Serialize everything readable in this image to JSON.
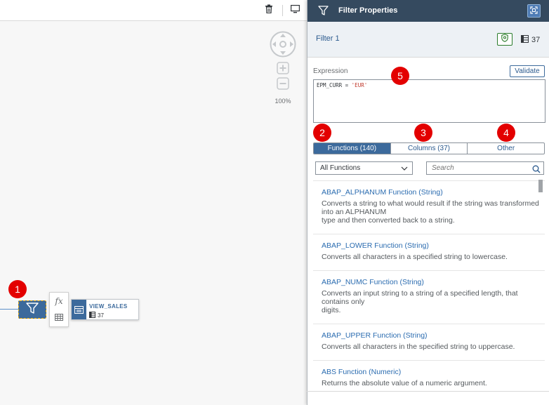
{
  "canvas": {
    "zoom_label": "100%",
    "node_menu": {
      "formula_label": "fx"
    },
    "view_node": {
      "name": "VIEW_SALES",
      "count": "37"
    }
  },
  "panel": {
    "title": "Filter Properties",
    "filter_name": "Filter 1",
    "column_count": "37",
    "expression_label": "Expression",
    "validate_label": "Validate",
    "expression": {
      "prefix": "EPM_CURR = ",
      "literal": "'EUR'"
    },
    "tabs": [
      {
        "label": "Functions (140)",
        "active": true
      },
      {
        "label": "Columns (37)",
        "active": false
      },
      {
        "label": "Other",
        "active": false
      }
    ],
    "function_filter": "All Functions",
    "search_placeholder": "Search",
    "functions": [
      {
        "name": "ABAP_ALPHANUM Function (String)",
        "desc": [
          "Converts a string to what would result if the string was transformed into an ALPHANUM",
          "type and then converted back to a string."
        ]
      },
      {
        "name": "ABAP_LOWER Function (String)",
        "desc": [
          "Converts all characters in a specified string to lowercase."
        ]
      },
      {
        "name": "ABAP_NUMC Function (String)",
        "desc": [
          "Converts an input string to a string of a specified length, that contains only",
          "digits."
        ]
      },
      {
        "name": "ABAP_UPPER Function (String)",
        "desc": [
          "Converts all characters in the specified string to uppercase."
        ]
      },
      {
        "name": "ABS Function (Numeric)",
        "desc": [
          "Returns the absolute value of a numeric argument."
        ]
      }
    ]
  },
  "callouts": [
    "1",
    "2",
    "3",
    "4",
    "5"
  ],
  "colors": {
    "header": "#354a5f",
    "accent": "#3c6a9c",
    "badge": "#e30000",
    "link": "#2b6cb0"
  }
}
